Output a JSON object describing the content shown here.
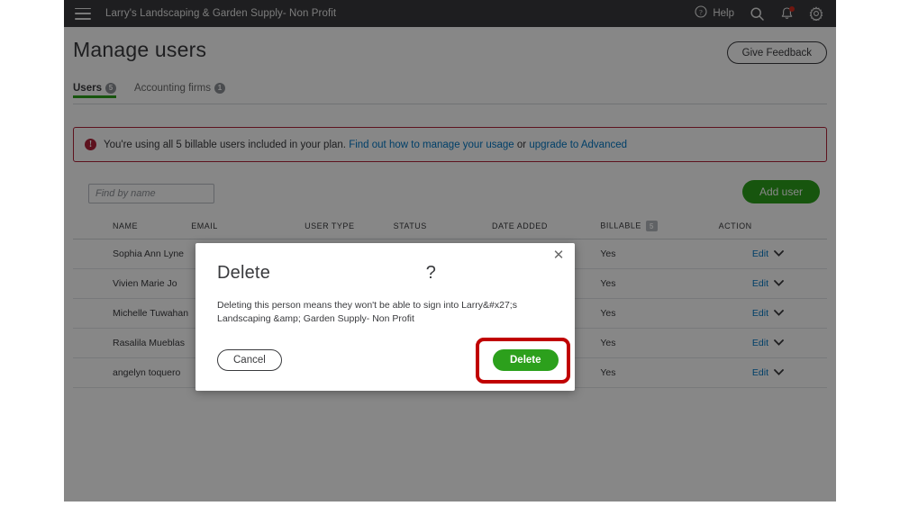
{
  "topbar": {
    "menu_icon": "hamburger-icon",
    "company": "Larry's Landscaping & Garden Supply- Non Profit",
    "help_label": "Help",
    "help_icon": "question-circle-icon",
    "search_icon": "search-icon",
    "notifications_icon": "bell-icon",
    "settings_icon": "gear-icon"
  },
  "header": {
    "title": "Manage users",
    "feedback_label": "Give Feedback"
  },
  "tabs": [
    {
      "label": "Users",
      "badge": "5",
      "active": true
    },
    {
      "label": "Accounting firms",
      "badge": "1",
      "active": false
    }
  ],
  "alert": {
    "icon": "exclamation-circle-icon",
    "icon_glyph": "!",
    "text_before": "You're using all 5 billable users included in your plan. ",
    "link1": "Find out how to manage your usage",
    "text_middle": " or ",
    "link2": "upgrade to Advanced",
    "border_color": "#b0233a",
    "link_color": "#0077c5"
  },
  "toolbar": {
    "search_placeholder": "Find by name",
    "add_user_label": "Add user",
    "add_user_color": "#2ca01c"
  },
  "table": {
    "columns": [
      "NAME",
      "EMAIL",
      "USER TYPE",
      "STATUS",
      "DATE ADDED",
      "BILLABLE",
      "ACTION"
    ],
    "billable_badge": "5",
    "rows": [
      {
        "name": "Sophia Ann Lyne",
        "email": "",
        "user_type": "",
        "status": "",
        "date_added": "",
        "billable": "Yes",
        "action": "Edit"
      },
      {
        "name": "Vivien Marie Jo",
        "email": "",
        "user_type": "",
        "status": "",
        "date_added": "",
        "billable": "Yes",
        "action": "Edit"
      },
      {
        "name": "Michelle Tuwahan",
        "email": "",
        "user_type": "",
        "status": "",
        "date_added": "",
        "billable": "Yes",
        "action": "Edit"
      },
      {
        "name": "Rasalila Mueblas",
        "email": "",
        "user_type": "",
        "status": "",
        "date_added": "",
        "billable": "Yes",
        "action": "Edit"
      },
      {
        "name": "angelyn toquero",
        "email": "",
        "user_type": "",
        "status": "",
        "date_added": "",
        "billable": "Yes",
        "action": "Edit"
      }
    ]
  },
  "modal": {
    "close_icon": "close-icon",
    "title": "Delete                              ?",
    "body": "Deleting this person means they won't be able to sign into Larry&#x27;s Landscaping &amp; Garden Supply- Non Profit",
    "cancel_label": "Cancel",
    "delete_label": "Delete",
    "delete_color": "#2ca01c",
    "highlight_color": "#c00000"
  }
}
